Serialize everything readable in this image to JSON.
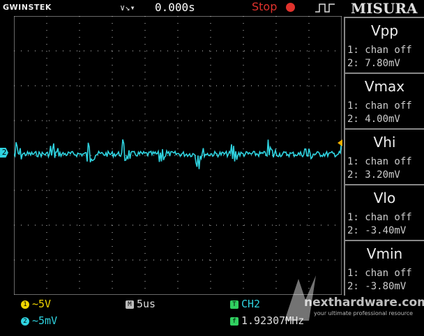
{
  "header": {
    "brand": "GWINSTEK",
    "trigger_icon": "trigger-edge-icon",
    "time_position": "0.000s",
    "run_state": "Stop",
    "menu_label": "MISURA"
  },
  "measurements": [
    {
      "name": "Vpp",
      "ch1": "1: chan off",
      "ch2": "2: 7.80mV"
    },
    {
      "name": "Vmax",
      "ch1": "1: chan off",
      "ch2": "2: 4.00mV"
    },
    {
      "name": "Vhi",
      "ch1": "1: chan off",
      "ch2": "2: 3.20mV"
    },
    {
      "name": "Vlo",
      "ch1": "1: chan off",
      "ch2": "2: -3.40mV"
    },
    {
      "name": "Vmin",
      "ch1": "1: chan off",
      "ch2": "2: -3.80mV"
    }
  ],
  "status": {
    "ch1_num": "1",
    "ch1_scale": "~5V",
    "ch2_num": "2",
    "ch2_scale": "~5mV",
    "timebase_icon": "M",
    "timebase": "5us",
    "trigger_icon": "T",
    "trigger_source": "CH2",
    "freq_icon": "f",
    "frequency": "1.92307MHz",
    "ch2_marker": "2"
  },
  "watermark": {
    "site": "nexthardware.com",
    "tagline": "your ultimate professional resource"
  },
  "colors": {
    "ch1": "#f2d600",
    "ch2": "#2fd3e0",
    "stop": "#e0322c",
    "grid": "#cfcfcf"
  }
}
